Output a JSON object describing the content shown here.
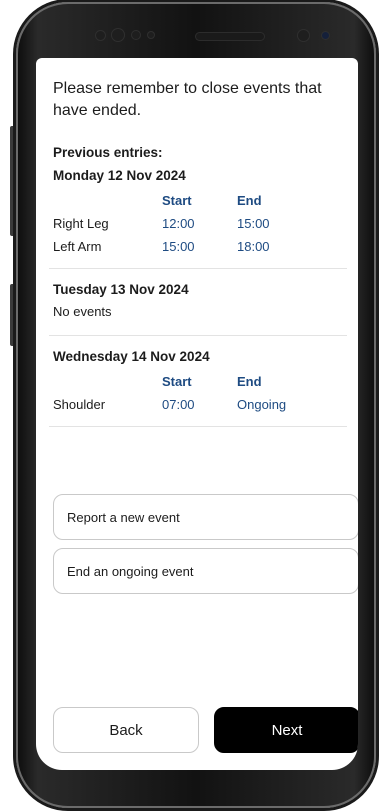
{
  "screen": {
    "reminder": "Please remember to close events that have ended."
  },
  "entries": {
    "title": "Previous entries:",
    "days": [
      {
        "title": "Monday 12 Nov 2024",
        "header": {
          "start": "Start",
          "end": "End"
        },
        "rows": [
          {
            "part": "Right Leg",
            "start": "12:00",
            "end": "15:00"
          },
          {
            "part": "Left Arm",
            "start": "15:00",
            "end": "18:00"
          }
        ]
      },
      {
        "title": "Tuesday 13 Nov 2024",
        "empty_text": "No events"
      },
      {
        "title": "Wednesday 14 Nov 2024",
        "header": {
          "start": "Start",
          "end": "End"
        },
        "rows": [
          {
            "part": "Shoulder",
            "start": "07:00",
            "end": "Ongoing"
          }
        ]
      }
    ]
  },
  "actions": {
    "report_new": "Report a new event",
    "end_ongoing": "End an ongoing event"
  },
  "nav": {
    "back": "Back",
    "next": "Next"
  },
  "colors": {
    "accent_text": "#1e4b82",
    "primary_button": "#000000"
  }
}
